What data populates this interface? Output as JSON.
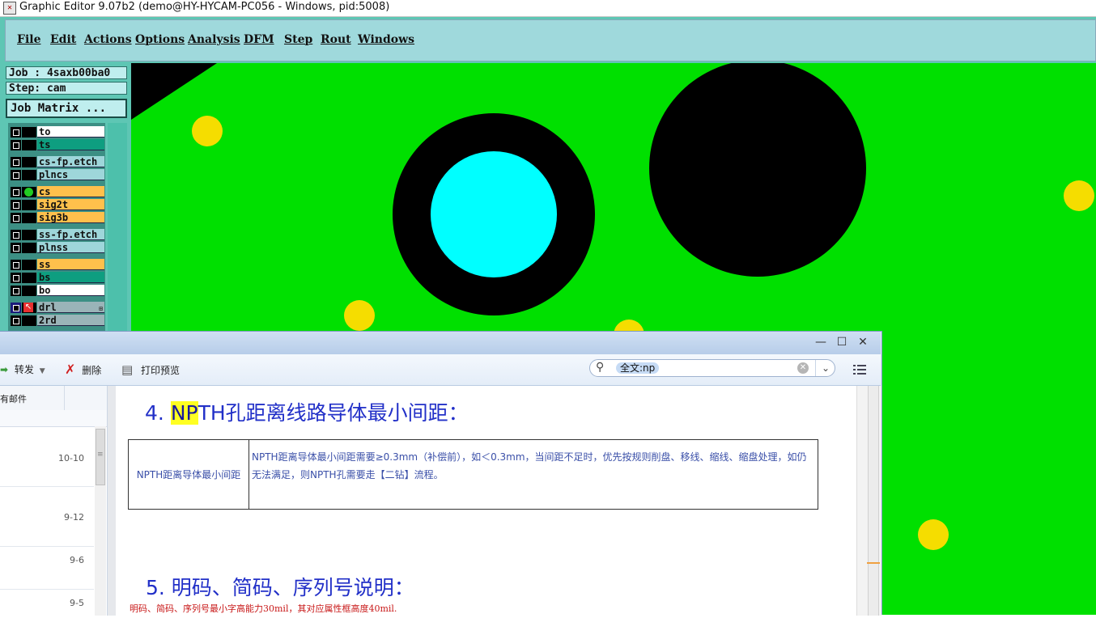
{
  "window": {
    "title": "Graphic Editor 9.07b2 (demo@HY-HYCAM-PC056 - Windows, pid:5008)",
    "icon": "app-icon"
  },
  "menu": [
    "File",
    "Edit",
    "Actions",
    "Options",
    "Analysis",
    "DFM",
    "Step",
    "Rout",
    "Windows"
  ],
  "job": {
    "job_label": "Job : 4saxb00ba0",
    "step_label": "Step: cam",
    "matrix_button": "Job Matrix ..."
  },
  "layers": [
    {
      "name": "to",
      "color": "#ffffff"
    },
    {
      "name": "ts",
      "color": "#0e9e80"
    },
    {
      "name": "cs-fp.etch",
      "color": "#9ed6da"
    },
    {
      "name": "plncs",
      "color": "#9ed6da"
    },
    {
      "name": "cs",
      "color": "#ffc04c",
      "active": true
    },
    {
      "name": "sig2t",
      "color": "#ffc04c"
    },
    {
      "name": "sig3b",
      "color": "#ffc04c"
    },
    {
      "name": "ss-fp.etch",
      "color": "#9ed6da"
    },
    {
      "name": "plnss",
      "color": "#9ed6da"
    },
    {
      "name": "ss",
      "color": "#ffc04c"
    },
    {
      "name": "bs",
      "color": "#0e9e80"
    },
    {
      "name": "bo",
      "color": "#ffffff"
    },
    {
      "name": "drl",
      "color": "#9ab4b8",
      "drill": true
    },
    {
      "name": "2rd",
      "color": "#9ab4b8"
    }
  ],
  "colors": {
    "board": "#00e000",
    "pad": "#f5dd00",
    "hole": "#000000",
    "highlight_pad": "#00ffff"
  },
  "doc": {
    "toolbar": {
      "forward": "转发",
      "delete": "删除",
      "print_preview": "打印预览"
    },
    "search": {
      "query": "全文:np"
    },
    "list": {
      "header": "有邮件",
      "dates": [
        "10-10",
        "9-12",
        "9-6",
        "9-5"
      ]
    },
    "heading4": {
      "prefix": "4. ",
      "highlight": "NP",
      "rest": "TH孔距离线路导体最小间距："
    },
    "table": {
      "label": "NPTH距离导体最小间距",
      "text": "NPTH距离导体最小间距需要≥0.3mm（补偿前），如＜0.3mm，当间距不足时，优先按规则削盘、移线、缩线、缩盘处理，如仍无法满足，则NPTH孔需要走【二钻】流程。"
    },
    "heading5": "5. 明码、简码、序列号说明：",
    "note": "明码、简码、序列号最小字高能力30mil，其对应属性框高度40mil."
  }
}
